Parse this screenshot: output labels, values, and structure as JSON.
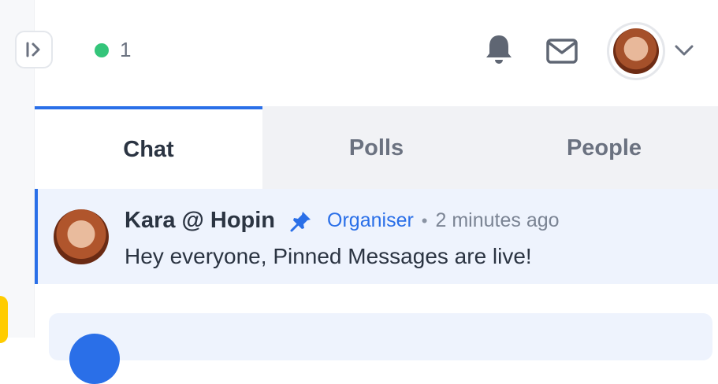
{
  "online": {
    "count": "1",
    "status_color": "#34c57a"
  },
  "header": {
    "icons": [
      "sidebar-expand-icon",
      "bell-icon",
      "mail-icon",
      "chevron-down-icon"
    ]
  },
  "tabs": [
    {
      "label": "Chat",
      "active": true
    },
    {
      "label": "Polls",
      "active": false
    },
    {
      "label": "People",
      "active": false
    }
  ],
  "pinned_message": {
    "author": "Kara @ Hopin",
    "role": "Organiser",
    "separator": "•",
    "time": "2 minutes ago",
    "text": "Hey everyone, Pinned Messages are live!"
  },
  "colors": {
    "accent": "#2a6fe8",
    "pinned_bg": "#eef3fd",
    "tab_bg": "#f1f2f5",
    "text_primary": "#2b3442",
    "text_muted": "#6b7280"
  }
}
